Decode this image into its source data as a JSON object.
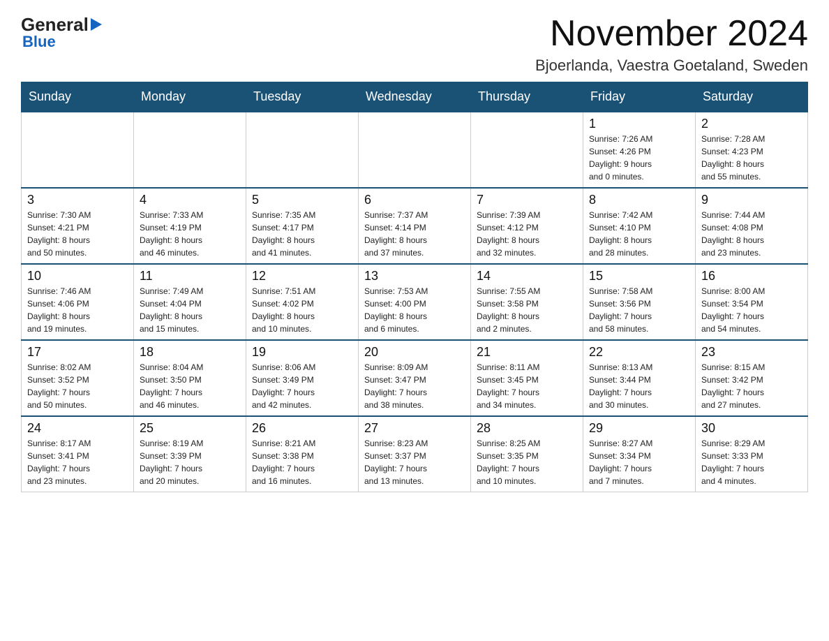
{
  "logo": {
    "general": "General",
    "blue": "Blue",
    "tagline": "Blue"
  },
  "title": "November 2024",
  "subtitle": "Bjoerlanda, Vaestra Goetaland, Sweden",
  "weekdays": [
    "Sunday",
    "Monday",
    "Tuesday",
    "Wednesday",
    "Thursday",
    "Friday",
    "Saturday"
  ],
  "weeks": [
    [
      {
        "day": "",
        "info": ""
      },
      {
        "day": "",
        "info": ""
      },
      {
        "day": "",
        "info": ""
      },
      {
        "day": "",
        "info": ""
      },
      {
        "day": "",
        "info": ""
      },
      {
        "day": "1",
        "info": "Sunrise: 7:26 AM\nSunset: 4:26 PM\nDaylight: 9 hours\nand 0 minutes."
      },
      {
        "day": "2",
        "info": "Sunrise: 7:28 AM\nSunset: 4:23 PM\nDaylight: 8 hours\nand 55 minutes."
      }
    ],
    [
      {
        "day": "3",
        "info": "Sunrise: 7:30 AM\nSunset: 4:21 PM\nDaylight: 8 hours\nand 50 minutes."
      },
      {
        "day": "4",
        "info": "Sunrise: 7:33 AM\nSunset: 4:19 PM\nDaylight: 8 hours\nand 46 minutes."
      },
      {
        "day": "5",
        "info": "Sunrise: 7:35 AM\nSunset: 4:17 PM\nDaylight: 8 hours\nand 41 minutes."
      },
      {
        "day": "6",
        "info": "Sunrise: 7:37 AM\nSunset: 4:14 PM\nDaylight: 8 hours\nand 37 minutes."
      },
      {
        "day": "7",
        "info": "Sunrise: 7:39 AM\nSunset: 4:12 PM\nDaylight: 8 hours\nand 32 minutes."
      },
      {
        "day": "8",
        "info": "Sunrise: 7:42 AM\nSunset: 4:10 PM\nDaylight: 8 hours\nand 28 minutes."
      },
      {
        "day": "9",
        "info": "Sunrise: 7:44 AM\nSunset: 4:08 PM\nDaylight: 8 hours\nand 23 minutes."
      }
    ],
    [
      {
        "day": "10",
        "info": "Sunrise: 7:46 AM\nSunset: 4:06 PM\nDaylight: 8 hours\nand 19 minutes."
      },
      {
        "day": "11",
        "info": "Sunrise: 7:49 AM\nSunset: 4:04 PM\nDaylight: 8 hours\nand 15 minutes."
      },
      {
        "day": "12",
        "info": "Sunrise: 7:51 AM\nSunset: 4:02 PM\nDaylight: 8 hours\nand 10 minutes."
      },
      {
        "day": "13",
        "info": "Sunrise: 7:53 AM\nSunset: 4:00 PM\nDaylight: 8 hours\nand 6 minutes."
      },
      {
        "day": "14",
        "info": "Sunrise: 7:55 AM\nSunset: 3:58 PM\nDaylight: 8 hours\nand 2 minutes."
      },
      {
        "day": "15",
        "info": "Sunrise: 7:58 AM\nSunset: 3:56 PM\nDaylight: 7 hours\nand 58 minutes."
      },
      {
        "day": "16",
        "info": "Sunrise: 8:00 AM\nSunset: 3:54 PM\nDaylight: 7 hours\nand 54 minutes."
      }
    ],
    [
      {
        "day": "17",
        "info": "Sunrise: 8:02 AM\nSunset: 3:52 PM\nDaylight: 7 hours\nand 50 minutes."
      },
      {
        "day": "18",
        "info": "Sunrise: 8:04 AM\nSunset: 3:50 PM\nDaylight: 7 hours\nand 46 minutes."
      },
      {
        "day": "19",
        "info": "Sunrise: 8:06 AM\nSunset: 3:49 PM\nDaylight: 7 hours\nand 42 minutes."
      },
      {
        "day": "20",
        "info": "Sunrise: 8:09 AM\nSunset: 3:47 PM\nDaylight: 7 hours\nand 38 minutes."
      },
      {
        "day": "21",
        "info": "Sunrise: 8:11 AM\nSunset: 3:45 PM\nDaylight: 7 hours\nand 34 minutes."
      },
      {
        "day": "22",
        "info": "Sunrise: 8:13 AM\nSunset: 3:44 PM\nDaylight: 7 hours\nand 30 minutes."
      },
      {
        "day": "23",
        "info": "Sunrise: 8:15 AM\nSunset: 3:42 PM\nDaylight: 7 hours\nand 27 minutes."
      }
    ],
    [
      {
        "day": "24",
        "info": "Sunrise: 8:17 AM\nSunset: 3:41 PM\nDaylight: 7 hours\nand 23 minutes."
      },
      {
        "day": "25",
        "info": "Sunrise: 8:19 AM\nSunset: 3:39 PM\nDaylight: 7 hours\nand 20 minutes."
      },
      {
        "day": "26",
        "info": "Sunrise: 8:21 AM\nSunset: 3:38 PM\nDaylight: 7 hours\nand 16 minutes."
      },
      {
        "day": "27",
        "info": "Sunrise: 8:23 AM\nSunset: 3:37 PM\nDaylight: 7 hours\nand 13 minutes."
      },
      {
        "day": "28",
        "info": "Sunrise: 8:25 AM\nSunset: 3:35 PM\nDaylight: 7 hours\nand 10 minutes."
      },
      {
        "day": "29",
        "info": "Sunrise: 8:27 AM\nSunset: 3:34 PM\nDaylight: 7 hours\nand 7 minutes."
      },
      {
        "day": "30",
        "info": "Sunrise: 8:29 AM\nSunset: 3:33 PM\nDaylight: 7 hours\nand 4 minutes."
      }
    ]
  ]
}
